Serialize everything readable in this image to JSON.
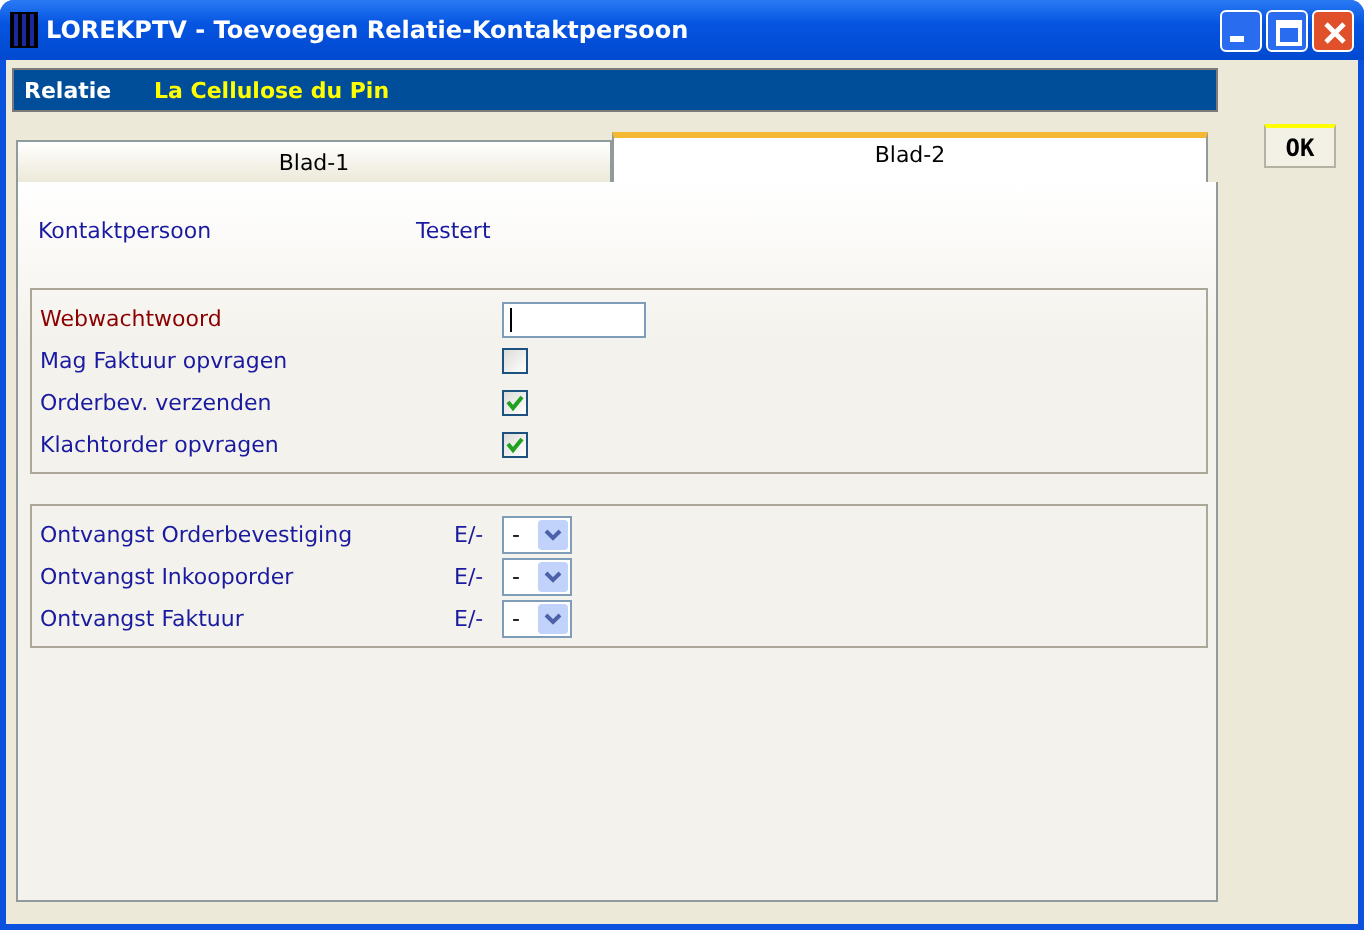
{
  "window": {
    "title": "LOREKPTV - Toevoegen Relatie-Kontaktpersoon"
  },
  "header": {
    "label": "Relatie",
    "value": "La Cellulose du Pin"
  },
  "tabs": [
    {
      "label": "Blad-1",
      "selected": false
    },
    {
      "label": "Blad-2",
      "selected": true
    }
  ],
  "contact": {
    "label": "Kontaktpersoon",
    "value": "Testert"
  },
  "settings": [
    {
      "kind": "field",
      "label": "Webwachtwoord",
      "required": true
    },
    {
      "kind": "checkbox",
      "label": "Mag Faktuur opvragen",
      "checked": false
    },
    {
      "kind": "checkbox",
      "label": "Orderbev. verzenden",
      "checked": true
    },
    {
      "kind": "checkbox",
      "label": "Klachtorder opvragen",
      "checked": true
    }
  ],
  "receipts": [
    {
      "label": "Ontvangst Orderbevestiging",
      "code": "E/-",
      "value": "-"
    },
    {
      "label": "Ontvangst Inkooporder",
      "code": "E/-",
      "value": "-"
    },
    {
      "label": "Ontvangst Faktuur",
      "code": "E/-",
      "value": "-"
    }
  ],
  "buttons": [
    "OK"
  ]
}
